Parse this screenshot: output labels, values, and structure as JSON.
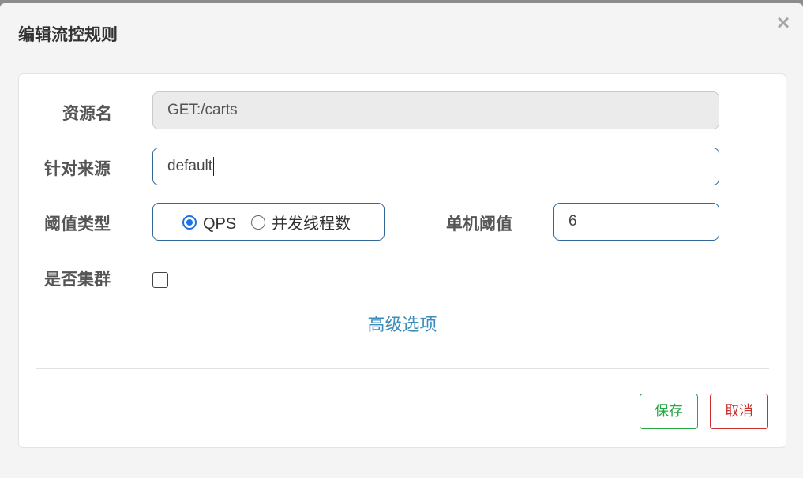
{
  "dialog": {
    "title": "编辑流控规则",
    "close_glyph": "×"
  },
  "form": {
    "resource": {
      "label": "资源名",
      "value": "GET:/carts"
    },
    "limit_app": {
      "label": "针对来源",
      "value": "default"
    },
    "grade": {
      "label": "阈值类型",
      "options": [
        {
          "label": "QPS",
          "checked": true
        },
        {
          "label": "并发线程数",
          "checked": false
        }
      ]
    },
    "count": {
      "label": "单机阈值",
      "value": "6"
    },
    "cluster": {
      "label": "是否集群",
      "checked": false
    },
    "advanced_link": "高级选项"
  },
  "footer": {
    "save_label": "保存",
    "cancel_label": "取消"
  },
  "colors": {
    "accent_border": "#336699",
    "radio_checked": "#1a73e8",
    "link": "#3c8dbc",
    "save": "#28a745",
    "cancel": "#c9302c"
  }
}
